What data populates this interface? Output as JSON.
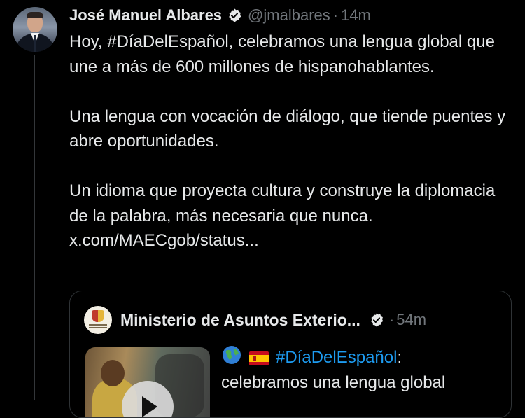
{
  "tweet": {
    "author_name": "José Manuel Albares",
    "handle": "@jmalbares",
    "separator": "·",
    "time": "14m",
    "paragraphs": [
      {
        "pre": "Hoy, ",
        "hashtag": "#DíaDelEspañol",
        "post": ", celebramos una lengua global que une a más de 600 millones de hispanohablantes."
      },
      {
        "text": "Una lengua con vocación de diálogo, que tiende puentes y abre oportunidades."
      },
      {
        "text": "Un idioma que proyecta cultura y construye la diplomacia de la palabra, más necesaria que nunca. ",
        "link": "x.com/MAECgob/status..."
      }
    ]
  },
  "quote": {
    "author_name": "Ministerio de Asuntos Exterio...",
    "separator": "·",
    "time": "54m",
    "hashtag": "#DíaDelEspañol",
    "after_hashtag": ":",
    "text": "celebramos una lengua global"
  },
  "icons": {
    "verified": "verified-badge-icon",
    "play": "play-icon",
    "globe": "globe-emoji-icon",
    "flag": "spain-flag-emoji-icon"
  },
  "colors": {
    "background": "#000000",
    "text_primary": "#e7e9ea",
    "text_secondary": "#71767b",
    "link_accent": "#1d9bf0",
    "border": "#2f3336"
  }
}
